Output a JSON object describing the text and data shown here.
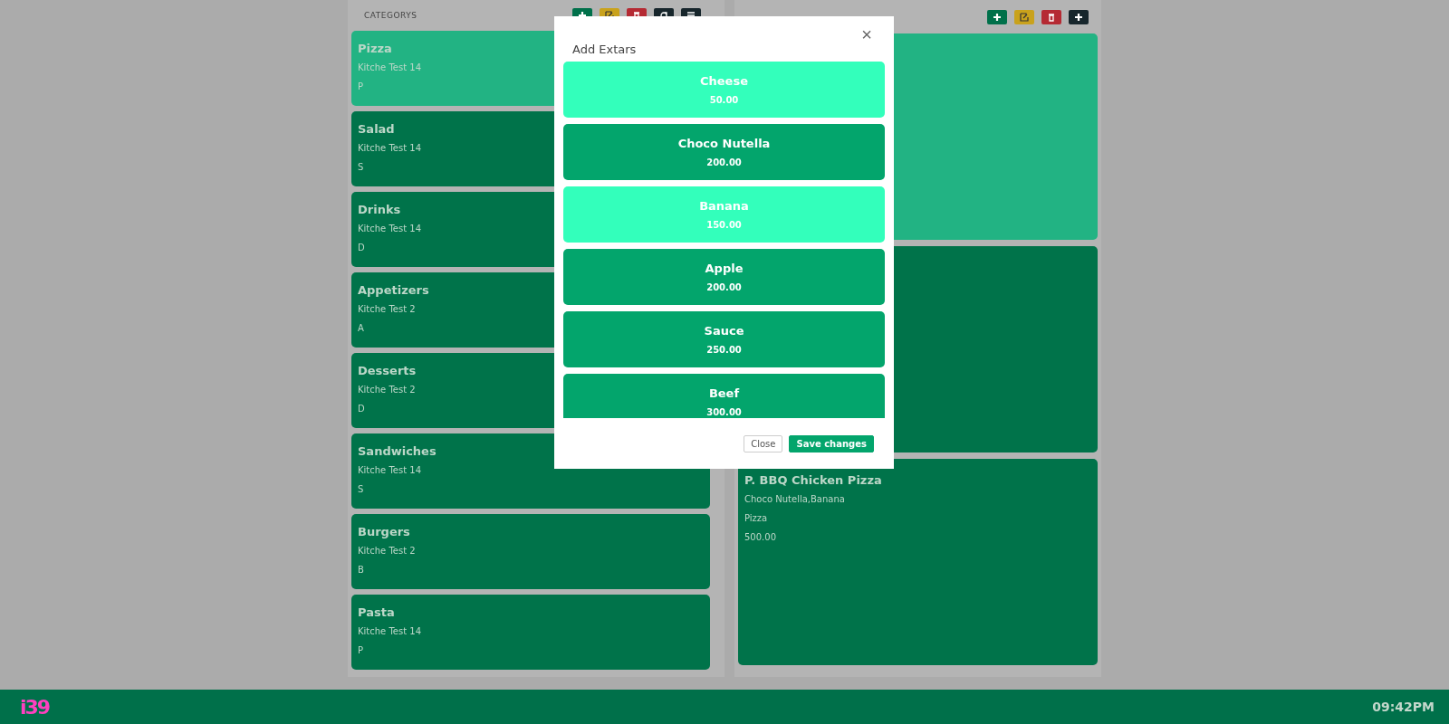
{
  "categories": {
    "title": "CATEGORYS",
    "actions": [
      {
        "kind": "add"
      },
      {
        "kind": "edit"
      },
      {
        "kind": "delete"
      },
      {
        "kind": "sync"
      },
      {
        "kind": "list"
      }
    ],
    "items": [
      {
        "name": "Pizza",
        "kitchen": "Kitche Test 14",
        "code": "P",
        "selected": true
      },
      {
        "name": "Salad",
        "kitchen": "Kitche Test 14",
        "code": "S",
        "selected": false
      },
      {
        "name": "Drinks",
        "kitchen": "Kitche Test 14",
        "code": "D",
        "selected": false
      },
      {
        "name": "Appetizers",
        "kitchen": "Kitche Test 2",
        "code": "A",
        "selected": false
      },
      {
        "name": "Desserts",
        "kitchen": "Kitche Test 2",
        "code": "D",
        "selected": false
      },
      {
        "name": "Sandwiches",
        "kitchen": "Kitche Test 14",
        "code": "S",
        "selected": false
      },
      {
        "name": "Burgers",
        "kitchen": "Kitche Test 2",
        "code": "B",
        "selected": false
      },
      {
        "name": "Pasta",
        "kitchen": "Kitche Test 14",
        "code": "P",
        "selected": false
      }
    ]
  },
  "products": {
    "actions": [
      {
        "kind": "add"
      },
      {
        "kind": "edit"
      },
      {
        "kind": "delete"
      },
      {
        "kind": "add-dark"
      }
    ],
    "items": [
      {
        "selected": true
      },
      {
        "selected": false
      },
      {
        "name": "P. BBQ Chicken Pizza",
        "extras": "Choco Nutella,Banana",
        "category": "Pizza",
        "price": "500.00",
        "selected": false
      }
    ]
  },
  "modal": {
    "title": "Add Extars",
    "close_icon": "×",
    "extras": [
      {
        "name": "Cheese",
        "price": "50.00",
        "selected": true
      },
      {
        "name": "Choco Nutella",
        "price": "200.00",
        "selected": false
      },
      {
        "name": "Banana",
        "price": "150.00",
        "selected": true
      },
      {
        "name": "Apple",
        "price": "200.00",
        "selected": false
      },
      {
        "name": "Sauce",
        "price": "250.00",
        "selected": false
      },
      {
        "name": "Beef",
        "price": "300.00",
        "selected": false
      }
    ],
    "buttons": [
      {
        "label": "Close",
        "kind": "secondary"
      },
      {
        "label": "Save changes",
        "kind": "primary"
      }
    ]
  },
  "status_bar": {
    "logo": "i39",
    "time": "09:42PM"
  }
}
